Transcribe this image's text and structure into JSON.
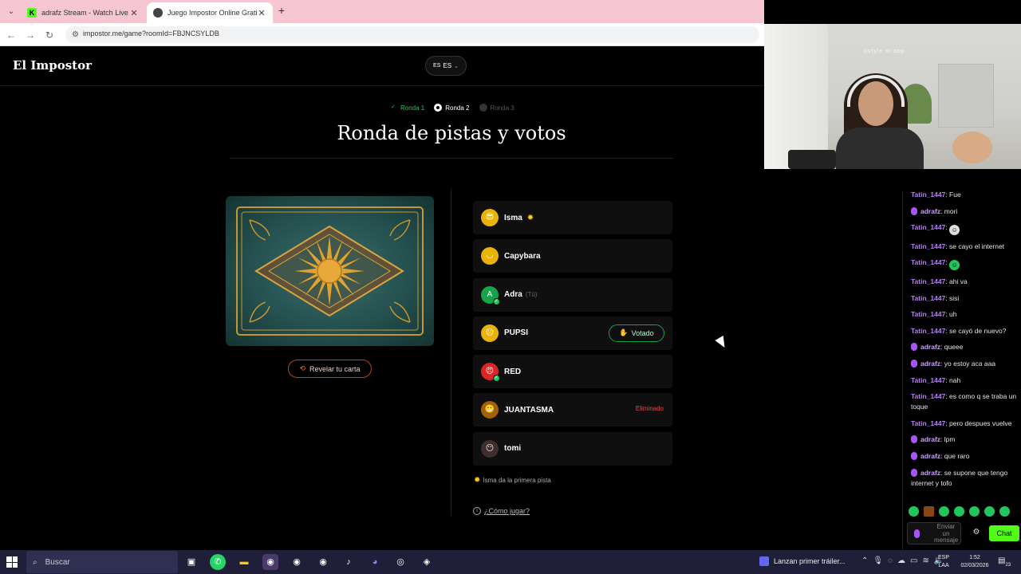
{
  "browser": {
    "tabs": [
      {
        "label": "adrafz Stream - Watch Live on K",
        "active": false
      },
      {
        "label": "Juego Impostor Online Gratis",
        "active": true
      }
    ],
    "url": "impostor.me/game?roomId=FBJNCSYLDB"
  },
  "page": {
    "brand": "El Impostor",
    "lang": {
      "flag": "ES",
      "code": "ES"
    },
    "rounds": [
      {
        "label": "Ronda 1",
        "state": "done"
      },
      {
        "label": "Ronda 2",
        "state": "current"
      },
      {
        "label": "Ronda 3",
        "state": "upcoming"
      }
    ],
    "title": "Ronda de pistas y votos",
    "reveal_label": "Revelar tu carta",
    "players": [
      {
        "name": "Isma",
        "tag": "",
        "status": "",
        "avatar": "😎",
        "avatar_color": "#eab308",
        "starter": true
      },
      {
        "name": "Capybara",
        "tag": "",
        "status": "",
        "avatar": "◡",
        "avatar_color": "#eab308",
        "starter": false
      },
      {
        "name": "Adra",
        "tag": "(Tú)",
        "status": "",
        "avatar": "A",
        "avatar_color": "#16a34a",
        "starter": false
      },
      {
        "name": "PUPSI",
        "tag": "",
        "status": "Votado",
        "avatar": "😐",
        "avatar_color": "#eab308",
        "starter": false
      },
      {
        "name": "RED",
        "tag": "",
        "status": "",
        "avatar": "😠",
        "avatar_color": "#dc2626",
        "starter": false
      },
      {
        "name": "JUANTASMA",
        "tag": "",
        "status": "Eliminado",
        "avatar": "😬",
        "avatar_color": "#a16207",
        "starter": false
      },
      {
        "name": "tomi",
        "tag": "",
        "status": "",
        "avatar": "😶",
        "avatar_color": "#3f2e2e",
        "starter": false
      }
    ],
    "hint": "Isma da la primera pista",
    "howto": "¿Cómo jugar?"
  },
  "stream": {
    "cam_overlay": "ustyle  m app",
    "chat": [
      {
        "user": "Tatin_1447",
        "text": "Fue",
        "mic": false
      },
      {
        "user": "adrafz",
        "text": "mori",
        "mic": true
      },
      {
        "user": "Tatin_1447",
        "text": "",
        "mic": false,
        "emote": true
      },
      {
        "user": "Tatin_1447",
        "text": "se cayo el internet",
        "mic": false
      },
      {
        "user": "Tatin_1447",
        "text": "",
        "mic": false,
        "emote": true
      },
      {
        "user": "Tatin_1447",
        "text": "ahi va",
        "mic": false
      },
      {
        "user": "Tatin_1447",
        "text": "sisi",
        "mic": false
      },
      {
        "user": "Tatin_1447",
        "text": "uh",
        "mic": false
      },
      {
        "user": "Tatin_1447",
        "text": "se cayó de nuevo?",
        "mic": false
      },
      {
        "user": "adrafz",
        "text": "queee",
        "mic": true
      },
      {
        "user": "adrafz",
        "text": "yo estoy aca aaa",
        "mic": true
      },
      {
        "user": "Tatin_1447",
        "text": "nah",
        "mic": false
      },
      {
        "user": "Tatin_1447",
        "text": "es como q se traba un toque",
        "mic": false
      },
      {
        "user": "Tatin_1447",
        "text": "pero despues vuelve",
        "mic": false
      },
      {
        "user": "adrafz",
        "text": "lpm",
        "mic": true
      },
      {
        "user": "adrafz",
        "text": "que raro",
        "mic": true
      },
      {
        "user": "adrafz",
        "text": "se supone que tengo internet y tofo",
        "mic": true
      }
    ],
    "input_placeholder": "Enviar un mensaje",
    "chat_button": "Chat"
  },
  "taskbar": {
    "search": "Buscar",
    "news": "Lanzan primer tráiler...",
    "lang_line1": "ESP",
    "lang_line2": "LAA",
    "time": "1:52",
    "date": "02/03/2026",
    "notif_count": "23"
  },
  "colors": {
    "accent_green": "#22c55e",
    "danger": "#ef4444",
    "kick_green": "#53fc18",
    "card_teal": "#24504f",
    "card_gold": "#c8952e"
  }
}
